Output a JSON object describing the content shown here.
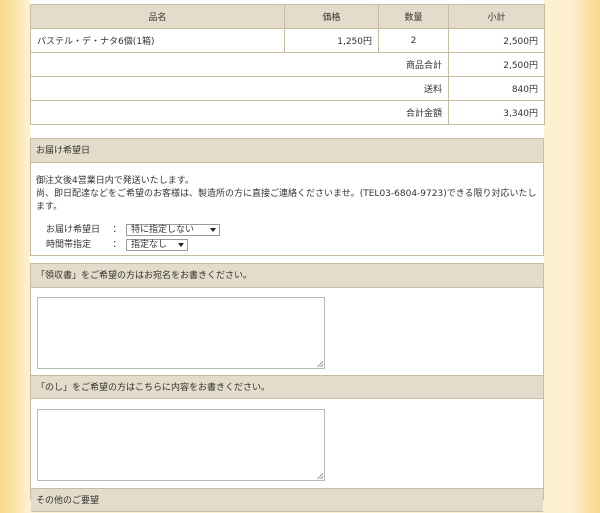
{
  "order_table": {
    "headers": [
      "品名",
      "価格",
      "数量",
      "小計"
    ],
    "items": [
      {
        "name": "パステル・デ・ナタ6個(1箱)",
        "price": "1,250円",
        "qty": "2",
        "subtotal": "2,500円"
      }
    ],
    "summary": [
      {
        "label": "商品合計",
        "value": "2,500円"
      },
      {
        "label": "送料",
        "value": "840円"
      },
      {
        "label": "合計金額",
        "value": "3,340円"
      }
    ]
  },
  "delivery": {
    "title": "お届け希望日",
    "line1": "御注文後4営業日内で発送いたします。",
    "line2": "尚、即日配達などをご希望のお客様は、製造所の方に直接ご連絡くださいませ。(TEL03-6804-9723)できる限り対応いたします。",
    "date_label": "お届け希望日",
    "date_value": "特に指定しない",
    "time_label": "時間帯指定",
    "time_value": "指定なし",
    "colon": "："
  },
  "receipt": {
    "title": "「領収書」をご希望の方はお宛名をお書きください。"
  },
  "noshi": {
    "title": "「のし」をご希望の方はこちらに内容をお書きください。"
  },
  "other": {
    "title": "その他のご要望"
  }
}
